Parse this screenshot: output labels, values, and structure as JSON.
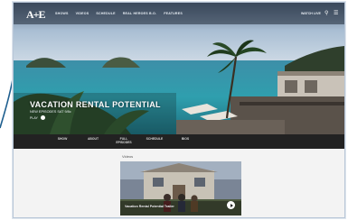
{
  "header": {
    "logo": "A+E",
    "nav": [
      "SHOWS",
      "VIDEOS",
      "SCHEDULE",
      "REAL HEROES B.O.",
      "FEATURES"
    ],
    "watch_live": "WATCH LIVE"
  },
  "hero": {
    "title": "VACATION RENTAL POTENTIAL",
    "subtitle": "NEW EPISODES SAT 9/8c",
    "meta": "PLAY"
  },
  "tabs": [
    "SHOW",
    "ABOUT",
    "FULL EPISODES",
    "SCHEDULE",
    "BIOS"
  ],
  "content": {
    "section_label": "Videos",
    "video_caption": "Vacation Rental Potential Trailer"
  },
  "colors": {
    "tabbar": "#222222",
    "content_bg": "#f3f3f3",
    "frame_border": "#b9c7d8"
  }
}
